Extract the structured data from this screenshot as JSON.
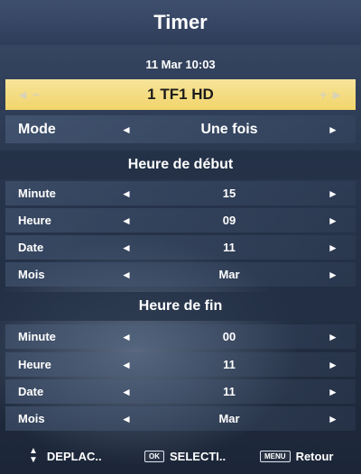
{
  "header": {
    "title": "Timer",
    "datetime": "11 Mar 10:03"
  },
  "channel": {
    "name": "1 TF1 HD",
    "left_symbols": "◄ −",
    "right_symbols": "+ ►"
  },
  "mode": {
    "label": "Mode",
    "value": "Une fois"
  },
  "start": {
    "title": "Heure de début",
    "rows": [
      {
        "label": "Minute",
        "value": "15"
      },
      {
        "label": "Heure",
        "value": "09"
      },
      {
        "label": "Date",
        "value": "11"
      },
      {
        "label": "Mois",
        "value": "Mar"
      }
    ]
  },
  "end": {
    "title": "Heure de fin",
    "rows": [
      {
        "label": "Minute",
        "value": "00"
      },
      {
        "label": "Heure",
        "value": "11"
      },
      {
        "label": "Date",
        "value": "11"
      },
      {
        "label": "Mois",
        "value": "Mar"
      }
    ]
  },
  "footer": {
    "move_label": "DEPLAC..",
    "ok_key": "OK",
    "select_label": "SELECTI..",
    "menu_key": "MENU",
    "back_label": "Retour"
  },
  "colors": {
    "highlight": "#f1d46a",
    "background": "#27344b"
  },
  "icons": {
    "left": "triangle-left",
    "right": "triangle-right",
    "updown": "up-down-arrows"
  }
}
